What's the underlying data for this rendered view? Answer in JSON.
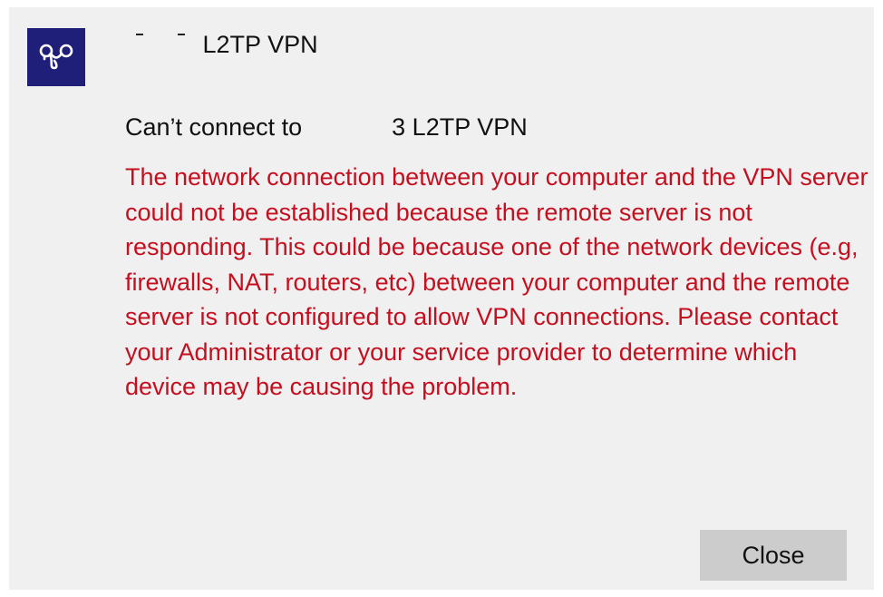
{
  "app_icon": "vpn-knot-icon",
  "connection_name": "L2TP VPN",
  "header": {
    "prefix": "Can’t connect to",
    "suffix": "3 L2TP VPN"
  },
  "error_message": "The network connection between your computer and the VPN server could not be established because the remote server is not responding. This could be because one of the network devices (e.g, firewalls, NAT, routers, etc) between your computer and the remote server is not configured to allow VPN connections. Please contact your Administrator or your service provider to determine which device may be causing the problem.",
  "buttons": {
    "close_label": "Close"
  },
  "colors": {
    "icon_bg": "#1f1f7a",
    "error_text": "#c50f1f",
    "dialog_bg": "#f0f0f0",
    "button_bg": "#cccccc"
  }
}
